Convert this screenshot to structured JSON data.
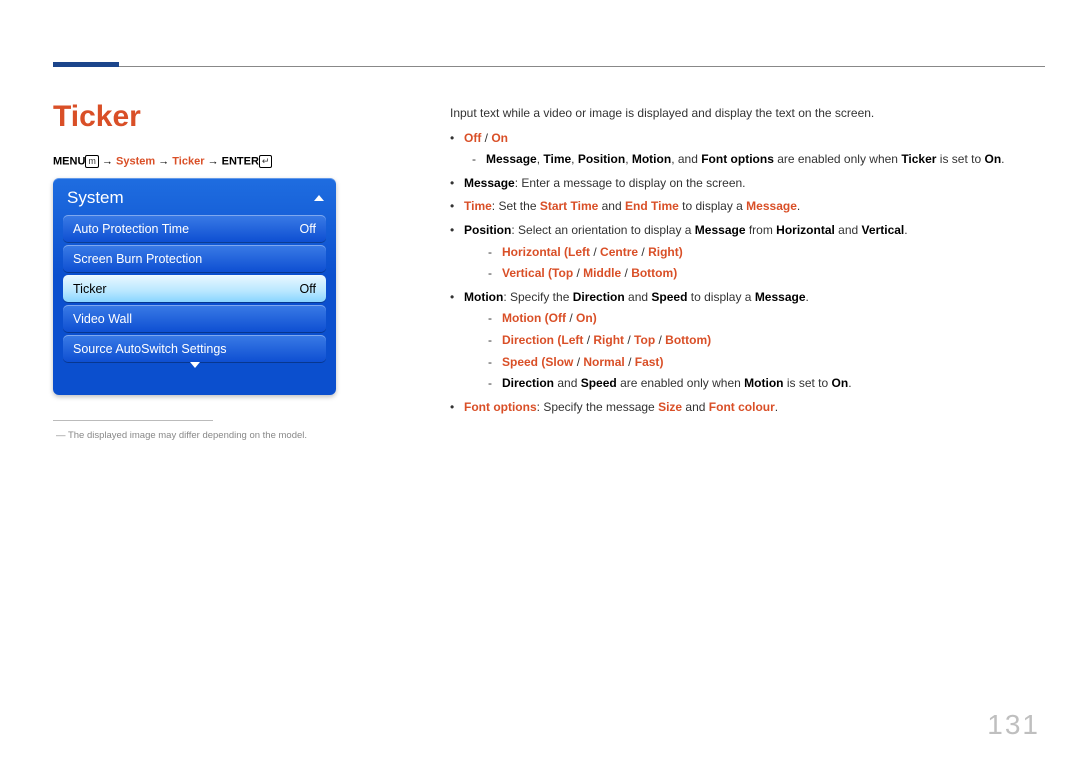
{
  "page": {
    "title": "Ticker",
    "number": "131"
  },
  "breadcrumb": {
    "menu": "MENU",
    "arrow": "→",
    "p1": "System",
    "p2": "Ticker",
    "enter": "ENTER"
  },
  "osd": {
    "title": "System",
    "items": [
      {
        "label": "Auto Protection Time",
        "value": "Off",
        "selected": false
      },
      {
        "label": "Screen Burn Protection",
        "value": "",
        "selected": false
      },
      {
        "label": "Ticker",
        "value": "Off",
        "selected": true
      },
      {
        "label": "Video Wall",
        "value": "",
        "selected": false
      },
      {
        "label": "Source AutoSwitch Settings",
        "value": "",
        "selected": false
      }
    ]
  },
  "footnote": "The displayed image may differ depending on the model.",
  "desc": {
    "intro": "Input text while a video or image is displayed and display the text on the screen.",
    "off": "Off",
    "on": "On",
    "slash": " / ",
    "note1a": "Message",
    "note1b": "Time",
    "note1c": "Position",
    "note1d": "Motion",
    "note1e": "Font options",
    "note1mid": " are enabled only when ",
    "note1ticker": "Ticker",
    "note1set": " is set to ",
    "note1on": "On",
    "msg_label": "Message",
    "msg_text": ": Enter a message to display on the screen.",
    "time_label": "Time",
    "time_text1": ": Set the ",
    "time_start": "Start Time",
    "time_and": " and ",
    "time_end": "End Time",
    "time_text2": " to display a ",
    "time_msg": "Message",
    "pos_label": "Position",
    "pos_text1": ": Select an orientation to display a ",
    "pos_msg": "Message",
    "pos_from": " from ",
    "pos_hor": "Horizontal",
    "pos_and": " and ",
    "pos_ver": "Vertical",
    "pos_h_label": "Horizontal",
    "pos_h_lp": "(",
    "pos_h_left": "Left",
    "pos_h_s1": " / ",
    "pos_h_centre": "Centre",
    "pos_h_s2": " / ",
    "pos_h_right": "Right",
    "pos_h_rp": ")",
    "pos_v_label": "Vertical",
    "pos_v_lp": "(",
    "pos_v_top": "Top",
    "pos_v_s1": " / ",
    "pos_v_mid": "Middle",
    "pos_v_s2": " / ",
    "pos_v_bot": "Bottom",
    "pos_v_rp": ")",
    "mot_label": "Motion",
    "mot_text1": ": Specify the ",
    "mot_dir": "Direction",
    "mot_and": " and ",
    "mot_spd": "Speed",
    "mot_text2": " to display a ",
    "mot_msg": "Message",
    "mot_m_label": "Motion",
    "mot_m_lp": "(",
    "mot_m_off": "Off",
    "mot_m_s": " / ",
    "mot_m_on": "On",
    "mot_m_rp": ")",
    "mot_d_label": "Direction",
    "mot_d_lp": "(",
    "mot_d_left": "Left",
    "mot_d_s1": " / ",
    "mot_d_right": "Right",
    "mot_d_s2": " / ",
    "mot_d_top": "Top",
    "mot_d_s3": " / ",
    "mot_d_bot": "Bottom",
    "mot_d_rp": ")",
    "mot_s_label": "Speed",
    "mot_s_lp": "(",
    "mot_s_slow": "Slow",
    "mot_s_s1": " / ",
    "mot_s_norm": "Normal",
    "mot_s_s2": " / ",
    "mot_s_fast": "Fast",
    "mot_s_rp": ")",
    "mot_note_dir": "Direction",
    "mot_note_and": " and ",
    "mot_note_spd": "Speed",
    "mot_note_mid": " are enabled only when ",
    "mot_note_mot": "Motion",
    "mot_note_set": " is set to ",
    "mot_note_on": "On",
    "font_label": "Font options",
    "font_text1": ": Specify the message ",
    "font_size": "Size",
    "font_and": " and ",
    "font_colour": "Font colour"
  }
}
